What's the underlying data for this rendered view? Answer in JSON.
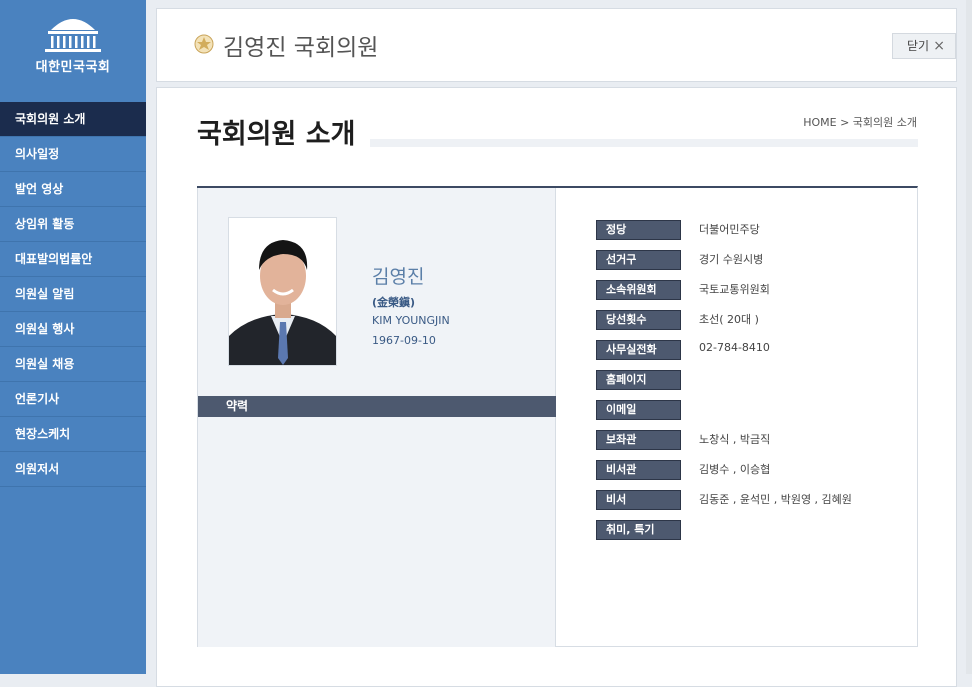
{
  "sidebar": {
    "logo_text": "대한민국국회",
    "items": [
      {
        "label": "국회의원 소개",
        "active": true
      },
      {
        "label": "의사일정"
      },
      {
        "label": "발언 영상"
      },
      {
        "label": "상임위 활동"
      },
      {
        "label": "대표발의법률안"
      },
      {
        "label": "의원실 알림"
      },
      {
        "label": "의원실 행사"
      },
      {
        "label": "의원실 채용"
      },
      {
        "label": "언론기사"
      },
      {
        "label": "현장스케치"
      },
      {
        "label": "의원저서"
      }
    ]
  },
  "header": {
    "title": "김영진 국회의원",
    "close_label": "닫기",
    "close_icon": "×"
  },
  "main": {
    "page_title": "국회의원 소개",
    "breadcrumb": "HOME > 국회의원 소개"
  },
  "profile": {
    "name_ko": "김영진",
    "name_hanja": "(金榮鎭)",
    "name_en": "KIM YOUNGJIN",
    "birth": "1967-09-10",
    "career_label": "약력"
  },
  "info": [
    {
      "label": "정당",
      "value": "더불어민주당"
    },
    {
      "label": "선거구",
      "value": "경기 수원시병"
    },
    {
      "label": "소속위원회",
      "value": "국토교통위원회"
    },
    {
      "label": "당선횟수",
      "value": "초선( 20대 )"
    },
    {
      "label": "사무실전화",
      "value": "02-784-8410"
    },
    {
      "label": "홈페이지",
      "value": ""
    },
    {
      "label": "이메일",
      "value": ""
    },
    {
      "label": "보좌관",
      "value": "노창식 , 박금직"
    },
    {
      "label": "비서관",
      "value": "김병수 , 이승협"
    },
    {
      "label": "비서",
      "value": "김동준 , 윤석민 , 박원영 , 김혜원"
    },
    {
      "label": "취미, 특기",
      "value": ""
    }
  ],
  "colors": {
    "sidebar_bg": "#4a82bf",
    "sidebar_active": "#1b2c4d",
    "label_bg": "#4d596f",
    "name_color": "#5b7fa8"
  }
}
